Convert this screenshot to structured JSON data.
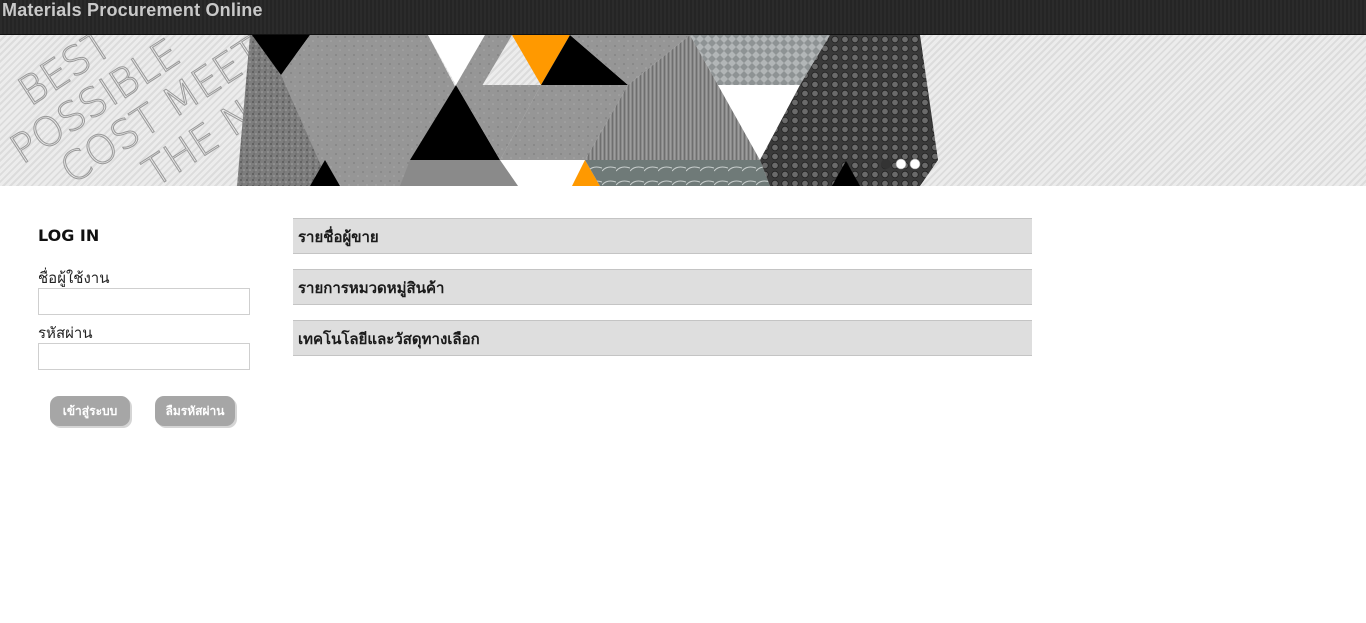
{
  "header": {
    "title": "Materials Procurement Online"
  },
  "banner": {
    "text_lines": [
      "BEST",
      "POSSIBLE",
      "COST MEET",
      "THE NEEDS"
    ],
    "slide_count": 3,
    "active_slide": 1,
    "colors": {
      "accent": "#ff9900",
      "dark": "#000000",
      "stone": "#8e8e8e"
    }
  },
  "login": {
    "title": "LOG IN",
    "username_label": "ชื่อผู้ใช้งาน",
    "username_value": "",
    "password_label": "รหัสผ่าน",
    "password_value": "",
    "login_button": "เข้าสู่ระบบ",
    "forgot_button": "ลืมรหัสผ่าน"
  },
  "menu": {
    "items": [
      {
        "label": "รายชื่อผู้ขาย"
      },
      {
        "label": "รายการหมวดหมู่สินค้า"
      },
      {
        "label": "เทคโนโลยีและวัสดุทางเลือก"
      }
    ]
  }
}
